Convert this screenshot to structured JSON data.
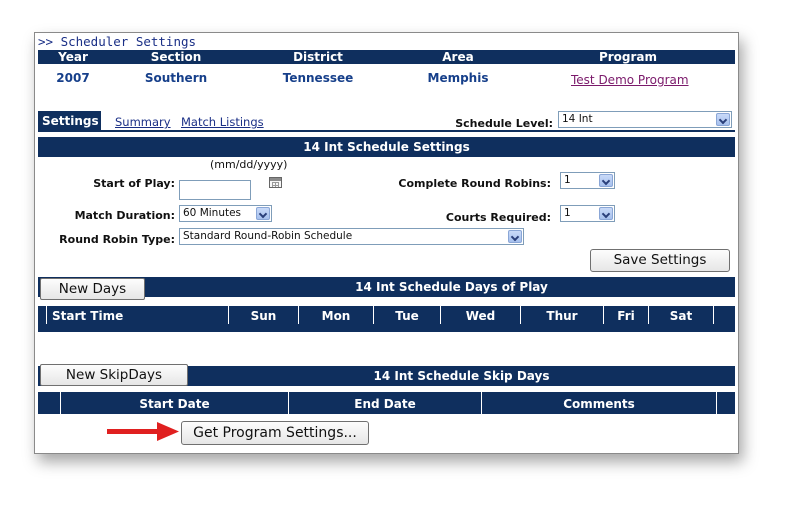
{
  "breadcrumb": ">> Scheduler Settings",
  "info_headers": [
    "Year",
    "Section",
    "District",
    "Area",
    "Program"
  ],
  "info_values": {
    "year": "2007",
    "section": "Southern",
    "district": "Tennessee",
    "area": "Memphis",
    "program": "Test Demo Program"
  },
  "tabs": {
    "settings": "Settings",
    "summary": "Summary",
    "match_listings": "Match Listings"
  },
  "schedule_level": {
    "label": "Schedule Level:",
    "value": "14 Int"
  },
  "settings_section": {
    "title": "14 Int Schedule Settings",
    "date_format": "(mm/dd/yyyy)",
    "start_of_play_label": "Start of Play:",
    "start_of_play_value": "",
    "complete_round_robins_label": "Complete Round Robins:",
    "complete_round_robins_value": "1",
    "match_duration_label": "Match Duration:",
    "match_duration_value": "60 Minutes",
    "courts_required_label": "Courts Required:",
    "courts_required_value": "1",
    "round_robin_type_label": "Round Robin Type:",
    "round_robin_type_value": "Standard Round-Robin Schedule",
    "save_button": "Save Settings"
  },
  "days_section": {
    "new_button": "New Days",
    "title": "14 Int Schedule Days of Play",
    "columns": [
      "Start Time",
      "Sun",
      "Mon",
      "Tue",
      "Wed",
      "Thur",
      "Fri",
      "Sat"
    ]
  },
  "skip_section": {
    "new_button": "New SkipDays",
    "title": "14 Int Schedule Skip Days",
    "columns": [
      "Start Date",
      "End Date",
      "Comments"
    ]
  },
  "get_program_button": "Get Program Settings...",
  "colors": {
    "navy": "#0f2f5e",
    "arrow": "#e02020",
    "link_purple": "#7b1a6b"
  }
}
